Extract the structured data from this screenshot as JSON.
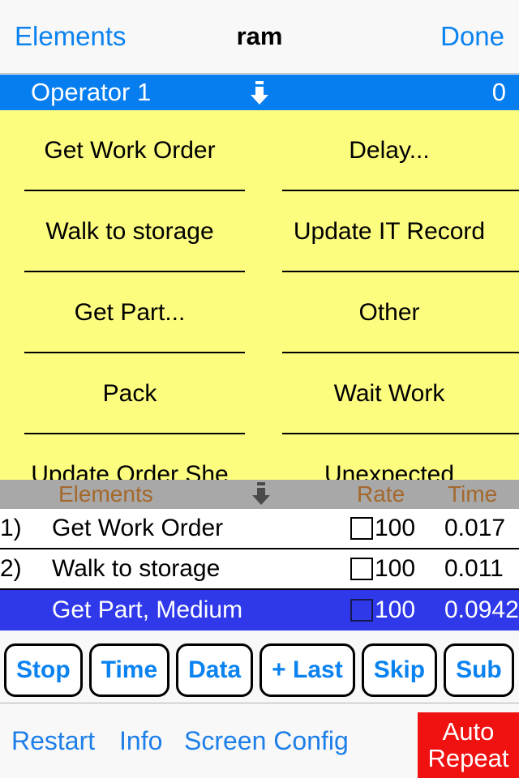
{
  "navbar": {
    "back_label": "Elements",
    "title": "ram",
    "done_label": "Done"
  },
  "operator_bar": {
    "name": "Operator 1",
    "count": "0",
    "icon": "down-arrow-icon",
    "background_color": "#067ef0"
  },
  "element_grid": {
    "background_color": "#fcfc7f",
    "rows": [
      {
        "left": "Get Work Order",
        "right": "Delay..."
      },
      {
        "left": "Walk to storage",
        "right": "Update IT Record"
      },
      {
        "left": "Get Part...",
        "right": "Other"
      },
      {
        "left": "Pack",
        "right": "Wait Work"
      },
      {
        "left": "Update Order She",
        "right": "Unexpected"
      }
    ]
  },
  "table": {
    "header": {
      "elements": "Elements",
      "rate": "Rate",
      "time": "Time",
      "icon": "down-arrow-icon",
      "background_color": "#a8a8a8",
      "text_color": "#a4682c"
    },
    "rows": [
      {
        "index": "1)",
        "name": "Get Work Order",
        "rate": "100",
        "time": "0.017",
        "selected": false
      },
      {
        "index": "2)",
        "name": "Walk to storage",
        "rate": "100",
        "time": "0.011",
        "selected": false
      },
      {
        "index": "",
        "name": "Get Part, Medium",
        "rate": "100",
        "time": "0.0942",
        "selected": true
      }
    ],
    "selected_color": "#2f39ea"
  },
  "action_buttons": [
    {
      "label": "Stop"
    },
    {
      "label": "Time"
    },
    {
      "label": "Data"
    },
    {
      "label": "+ Last"
    },
    {
      "label": "Skip"
    },
    {
      "label": "Sub"
    }
  ],
  "toolbar": {
    "restart_label": "Restart",
    "info_label": "Info",
    "screen_config_label": "Screen Config",
    "auto_repeat_line1": "Auto",
    "auto_repeat_line2": "Repeat",
    "auto_repeat_color": "#f01111"
  }
}
